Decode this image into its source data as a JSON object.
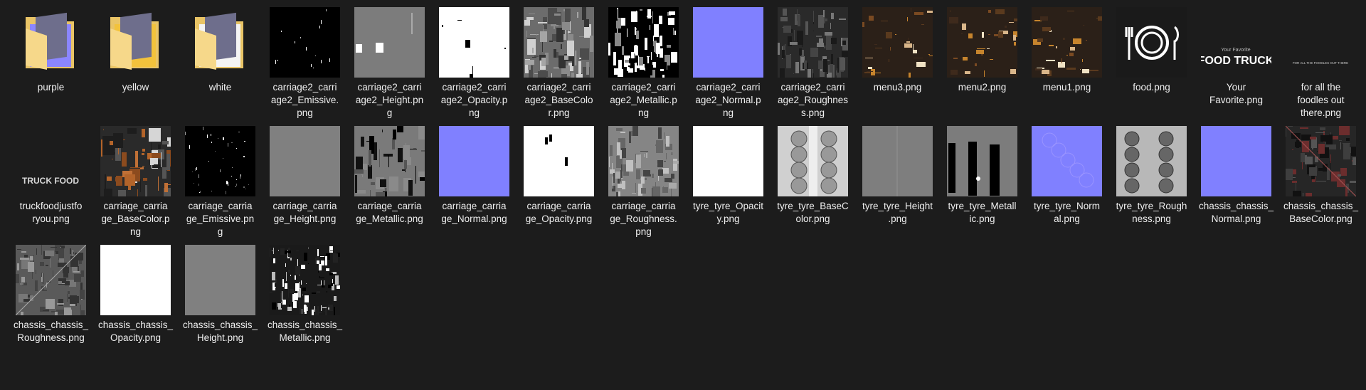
{
  "window": {
    "view": "Large icons",
    "background": "#1c1c1c"
  },
  "items": [
    {
      "name": "purple",
      "kind": "folder",
      "preview": "purple",
      "icon": "folder-icon"
    },
    {
      "name": "yellow",
      "kind": "folder",
      "preview": "yellow",
      "icon": "folder-icon"
    },
    {
      "name": "white",
      "kind": "folder",
      "preview": "white",
      "icon": "folder-icon"
    },
    {
      "name": "carriage2_carriage2_Emissive.png",
      "label_lines": [
        "carriage2_carri",
        "age2_Emissive.",
        "png"
      ],
      "kind": "image",
      "preview": "emissive"
    },
    {
      "name": "carriage2_carriage2_Height.png",
      "label_lines": [
        "carriage2_carri",
        "age2_Height.pn",
        "g"
      ],
      "kind": "image",
      "preview": "height-blocks"
    },
    {
      "name": "carriage2_carriage2_Opacity.png",
      "label_lines": [
        "carriage2_carri",
        "age2_Opacity.p",
        "ng"
      ],
      "kind": "image",
      "preview": "opacity-white"
    },
    {
      "name": "carriage2_carriage2_BaseColor.png",
      "label_lines": [
        "carriage2_carri",
        "age2_BaseColo",
        "r.png"
      ],
      "kind": "image",
      "preview": "gray-texture"
    },
    {
      "name": "carriage2_carriage2_Metallic.png",
      "label_lines": [
        "carriage2_carri",
        "age2_Metallic.p",
        "ng"
      ],
      "kind": "image",
      "preview": "metallic-bw"
    },
    {
      "name": "carriage2_carriage2_Normal.png",
      "label_lines": [
        "carriage2_carri",
        "age2_Normal.p",
        "ng"
      ],
      "kind": "image",
      "preview": "normal-blue"
    },
    {
      "name": "carriage2_carriage2_Roughness.png",
      "label_lines": [
        "carriage2_carri",
        "age2_Roughnes",
        "s.png"
      ],
      "kind": "image",
      "preview": "dark-texture"
    },
    {
      "name": "menu3.png",
      "kind": "image",
      "preview": "menu"
    },
    {
      "name": "menu2.png",
      "kind": "image",
      "preview": "menu"
    },
    {
      "name": "menu1.png",
      "kind": "image",
      "preview": "menu"
    },
    {
      "name": "food.png",
      "kind": "image",
      "preview": "food-icon"
    },
    {
      "name": "Your Favorite.png",
      "label_lines": [
        "Your",
        "Favorite.png"
      ],
      "kind": "image",
      "preview": "foodtruck-logo",
      "preview_text": {
        "small": "Your Favorite",
        "big": "FOOD TRUCK"
      }
    },
    {
      "name": "for all the foodles out there.png",
      "label_lines": [
        "for all the",
        "foodles out",
        "there.png"
      ],
      "kind": "image",
      "preview": "tagline",
      "preview_text": {
        "small": "FOR ALL THE FOODLES OUT THERE"
      }
    },
    {
      "name": "truckfoodjustforyou.png",
      "label_lines": [
        "truckfoodjustfo",
        "ryou.png"
      ],
      "kind": "image",
      "preview": "truckfood-text",
      "preview_text": {
        "big": "TRUCK FOOD"
      }
    },
    {
      "name": "carriage_carriage_BaseColor.png",
      "label_lines": [
        "carriage_carria",
        "ge_BaseColor.p",
        "ng"
      ],
      "kind": "image",
      "preview": "brown-texture"
    },
    {
      "name": "carriage_carriage_Emissive.png",
      "label_lines": [
        "carriage_carria",
        "ge_Emissive.pn",
        "g"
      ],
      "kind": "image",
      "preview": "emissive2"
    },
    {
      "name": "carriage_carriage_Height.png",
      "label_lines": [
        "carriage_carria",
        "ge_Height.png"
      ],
      "kind": "image",
      "preview": "flat-gray"
    },
    {
      "name": "carriage_carriage_Metallic.png",
      "label_lines": [
        "carriage_carria",
        "ge_Metallic.png"
      ],
      "kind": "image",
      "preview": "metallic-gray"
    },
    {
      "name": "carriage_carriage_Normal.png",
      "label_lines": [
        "carriage_carria",
        "ge_Normal.png"
      ],
      "kind": "image",
      "preview": "normal-blue"
    },
    {
      "name": "carriage_carriage_Opacity.png",
      "label_lines": [
        "carriage_carria",
        "ge_Opacity.png"
      ],
      "kind": "image",
      "preview": "opacity-marks"
    },
    {
      "name": "carriage_carriage_Roughness.png",
      "label_lines": [
        "carriage_carria",
        "ge_Roughness.",
        "png"
      ],
      "kind": "image",
      "preview": "rough-gray"
    },
    {
      "name": "tyre_tyre_Opacity.png",
      "label_lines": [
        "tyre_tyre_Opacit",
        "y.png"
      ],
      "kind": "image",
      "preview": "white-plain"
    },
    {
      "name": "tyre_tyre_BaseColor.png",
      "label_lines": [
        "tyre_tyre_BaseC",
        "olor.png"
      ],
      "kind": "image",
      "preview": "tyre-base"
    },
    {
      "name": "tyre_tyre_Height.png",
      "label_lines": [
        "tyre_tyre_Height",
        ".png"
      ],
      "kind": "image",
      "preview": "flat-gray2"
    },
    {
      "name": "tyre_tyre_Metallic.png",
      "label_lines": [
        "tyre_tyre_Metall",
        "ic.png"
      ],
      "kind": "image",
      "preview": "tyre-metallic"
    },
    {
      "name": "tyre_tyre_Normal.png",
      "label_lines": [
        "tyre_tyre_Norm",
        "al.png"
      ],
      "kind": "image",
      "preview": "normal-blue-tyre"
    },
    {
      "name": "tyre_tyre_Roughness.png",
      "label_lines": [
        "tyre_tyre_Rough",
        "ness.png"
      ],
      "kind": "image",
      "preview": "tyre-rough"
    },
    {
      "name": "chassis_chassis_Normal.png",
      "label_lines": [
        "chassis_chassis_",
        "Normal.png"
      ],
      "kind": "image",
      "preview": "normal-blue"
    },
    {
      "name": "chassis_chassis_BaseColor.png",
      "label_lines": [
        "chassis_chassis_",
        "BaseColor.png"
      ],
      "kind": "image",
      "preview": "chassis-dark"
    },
    {
      "name": "chassis_chassis_Roughness.png",
      "label_lines": [
        "chassis_chassis_",
        "Roughness.png"
      ],
      "kind": "image",
      "preview": "chassis-rough"
    },
    {
      "name": "chassis_chassis_Opacity.png",
      "label_lines": [
        "chassis_chassis_",
        "Opacity.png"
      ],
      "kind": "image",
      "preview": "white-plain"
    },
    {
      "name": "chassis_chassis_Height.png",
      "label_lines": [
        "chassis_chassis_",
        "Height.png"
      ],
      "kind": "image",
      "preview": "flat-gray"
    },
    {
      "name": "chassis_chassis_Metallic.png",
      "label_lines": [
        "chassis_chassis_",
        "Metallic.png"
      ],
      "kind": "image",
      "preview": "chassis-metallic"
    }
  ],
  "colors": {
    "folder_back": "#e9c466",
    "folder_front": "#f6d88a",
    "normal_blue": "#8080ff",
    "purple_tab": "#8b86ff",
    "yellow_tab": "#f2c23c",
    "white_tab": "#f4f4f4"
  }
}
